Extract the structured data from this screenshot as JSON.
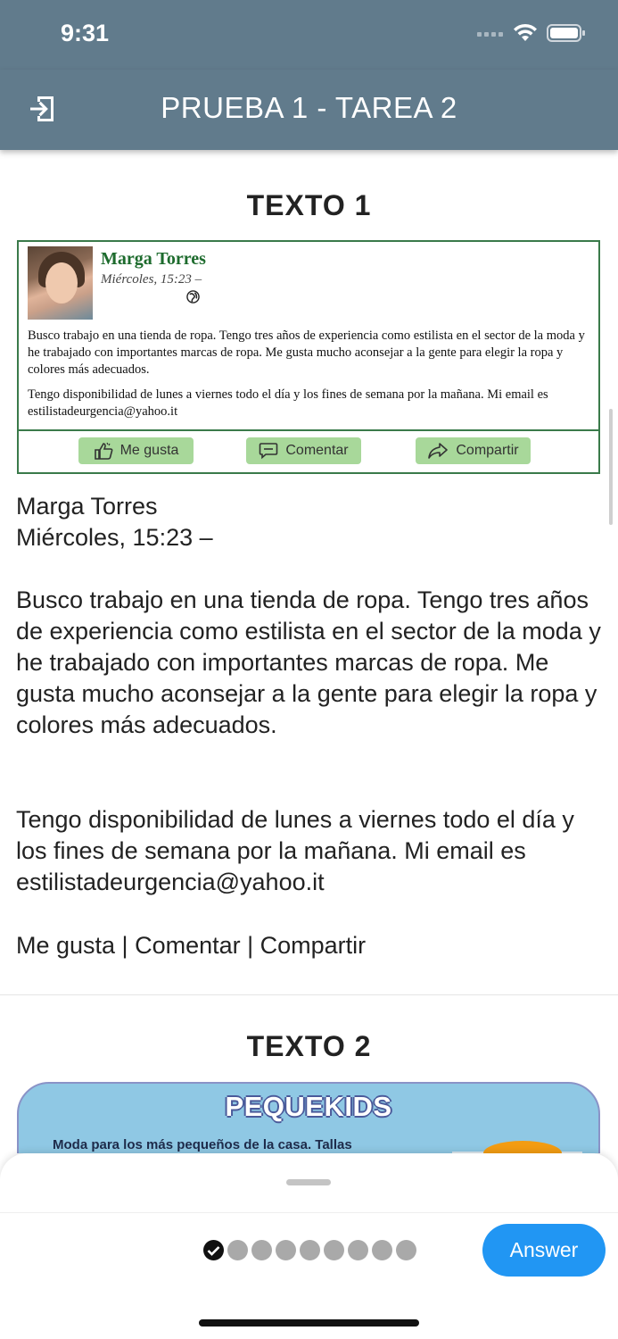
{
  "status_bar": {
    "time": "9:31"
  },
  "app_bar": {
    "title": "PRUEBA 1 - TAREA 2",
    "exit_icon": "exit-icon"
  },
  "texto1": {
    "heading": "TEXTO 1",
    "card": {
      "name": "Marga Torres",
      "date": "Miércoles, 15:23 –",
      "paragraph1": "Busco trabajo en una tienda de ropa. Tengo tres años de experiencia como estilista en el sector de la moda y he trabajado con importantes marcas de ropa. Me gusta mucho aconsejar a la gente para elegir la ropa y colores más adecuados.",
      "paragraph2": "Tengo disponibilidad de lunes a viernes todo el día y los fines de semana por la mañana. Mi email es estilistadeurgencia@yahoo.it",
      "actions": [
        "Me gusta",
        "Comentar",
        "Compartir"
      ]
    },
    "transcript": {
      "name": "Marga Torres",
      "date": "Miércoles, 15:23 –",
      "paragraph1": "Busco trabajo en una tienda de ropa. Tengo tres años de experiencia como estilista en el sector de la moda y he trabajado con importantes marcas de ropa. Me gusta mucho aconsejar a la gente para elegir la ropa y colores más adecuados.",
      "paragraph2": "Tengo disponibilidad de lunes a viernes todo el día y los fines de semana por la mañana. Mi email es estilistadeurgencia@yahoo.it",
      "actions_line": "Me gusta | Comentar | Compartir"
    }
  },
  "texto2": {
    "heading": "TEXTO 2",
    "brand": "PEQUEKIDS",
    "subtitle": "Moda para los más pequeños de la casa. Tallas"
  },
  "bottom_sheet": {
    "progress": {
      "completed": 1,
      "total": 9
    },
    "answer_label": "Answer"
  },
  "colors": {
    "app_bar": "#617b8c",
    "card_border": "#3a7a4a",
    "card_name": "#1d6b2d",
    "action_button": "#a8d89a",
    "answer_button": "#2196f3",
    "peque_background": "#8fc8e4"
  }
}
